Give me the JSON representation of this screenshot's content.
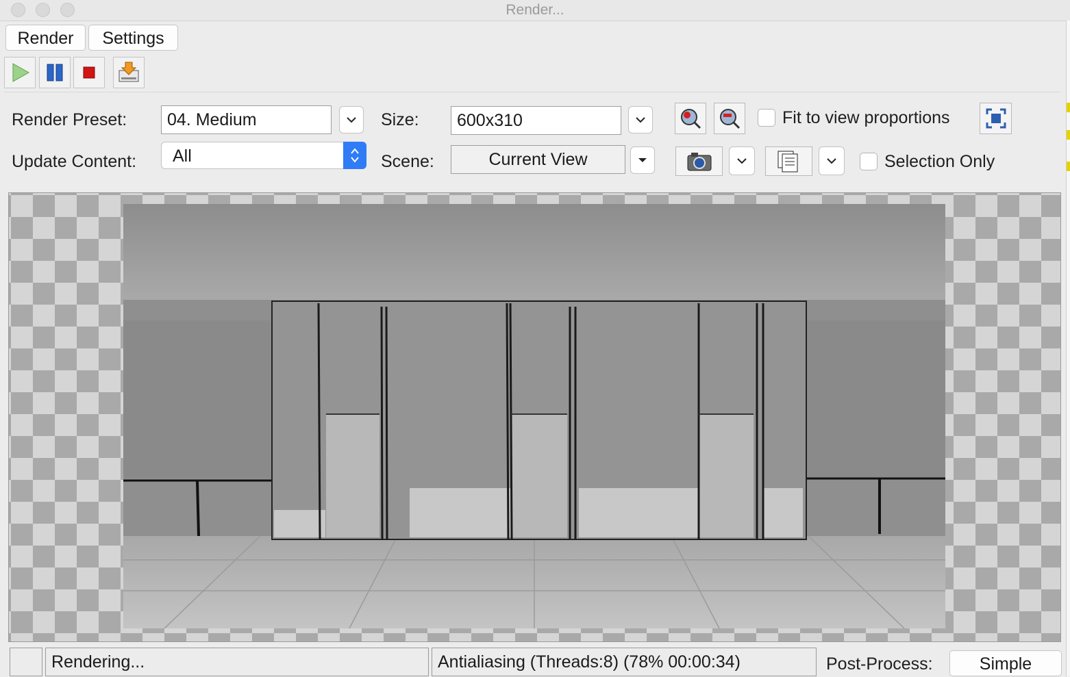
{
  "window": {
    "title": "Render..."
  },
  "menu": {
    "render_label": "Render",
    "settings_label": "Settings"
  },
  "toolbar": {
    "buttons": [
      "play-icon",
      "pause-icon",
      "stop-icon",
      "export-icon"
    ]
  },
  "settings": {
    "render_preset_label": "Render Preset:",
    "render_preset_value": "04. Medium",
    "update_content_label": "Update Content:",
    "update_content_value": "All",
    "size_label": "Size:",
    "size_value": "600x310",
    "scene_label": "Scene:",
    "scene_value": "Current View",
    "fit_to_view_label": "Fit to view proportions",
    "fit_to_view_checked": false,
    "selection_only_label": "Selection Only",
    "selection_only_checked": false
  },
  "status": {
    "state": "Rendering...",
    "progress_text": "Antialiasing (Threads:8) (78% 00:00:34)",
    "post_process_label": "Post-Process:",
    "post_process_value": "Simple"
  },
  "colors": {
    "checker_dark": "#a9a9a9",
    "checker_light": "#d5d5d5",
    "dropdown_accent": "#2f7cf6"
  }
}
